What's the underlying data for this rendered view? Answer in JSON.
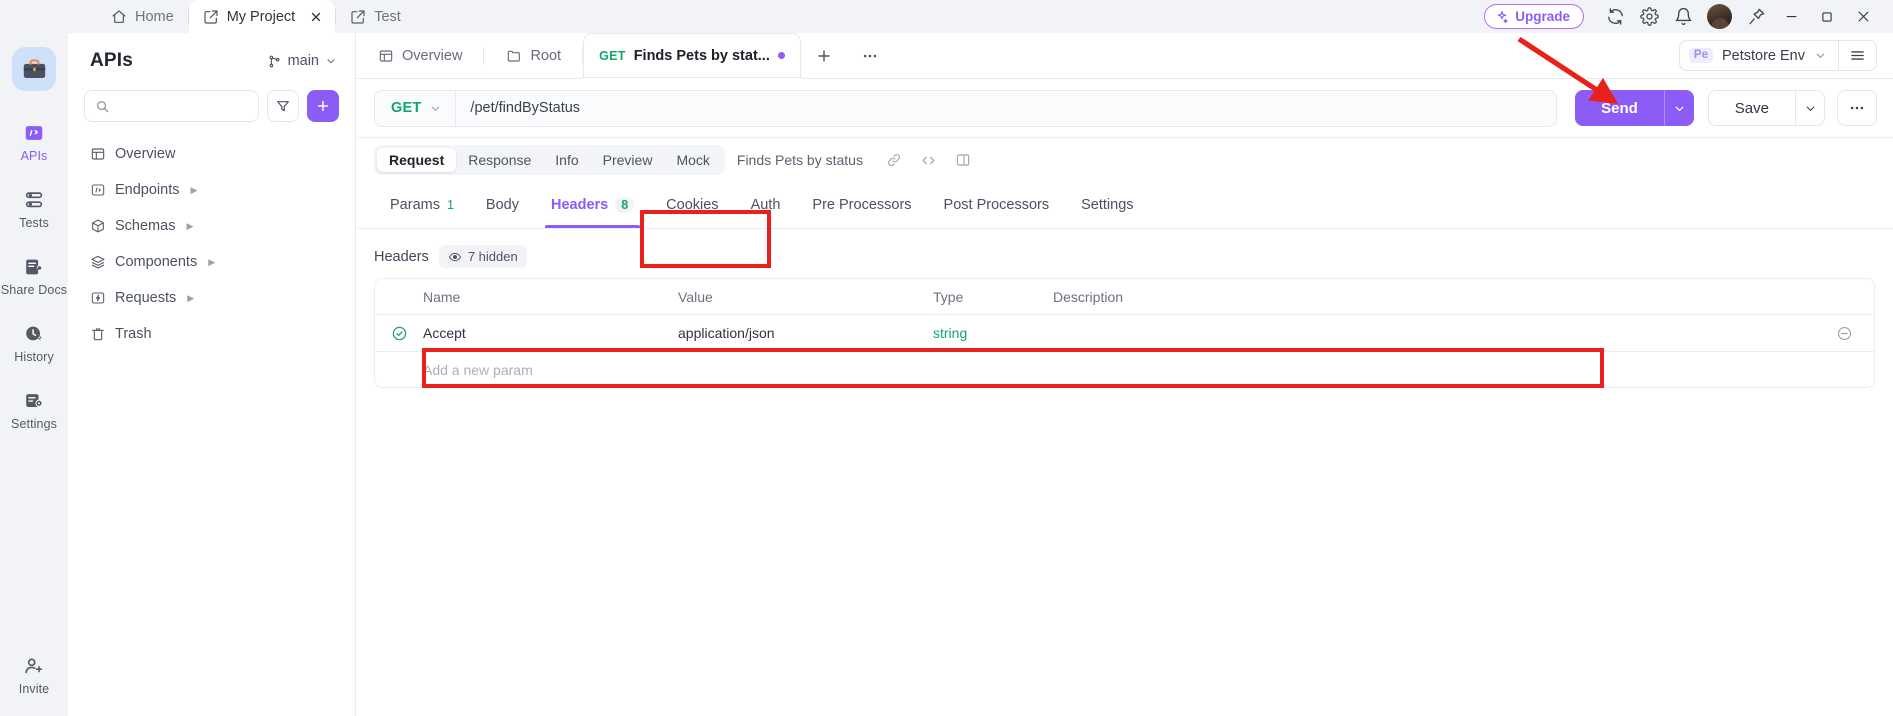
{
  "titlebar": {
    "tabs": [
      {
        "label": "Home",
        "icon": "home-icon",
        "active": false,
        "closable": false
      },
      {
        "label": "My Project",
        "icon": "external-window-icon",
        "active": true,
        "closable": true
      },
      {
        "label": "Test",
        "icon": "external-window-icon",
        "active": false,
        "closable": false
      }
    ],
    "upgrade_label": "Upgrade",
    "icons": [
      "sync-icon",
      "gear-icon",
      "bell-icon",
      "avatar",
      "pin-icon"
    ],
    "window_controls": [
      "minimize-icon",
      "maximize-icon",
      "close-icon"
    ]
  },
  "rail": {
    "logo": "briefcase-icon",
    "items": [
      {
        "label": "APIs",
        "icon": "apis-icon",
        "active": true
      },
      {
        "label": "Tests",
        "icon": "tests-icon",
        "active": false
      },
      {
        "label": "Share Docs",
        "icon": "share-docs-icon",
        "active": false
      },
      {
        "label": "History",
        "icon": "history-icon",
        "active": false
      },
      {
        "label": "Settings",
        "icon": "settings-icon",
        "active": false
      }
    ],
    "bottom": {
      "label": "Invite",
      "icon": "invite-user-icon"
    }
  },
  "panel": {
    "title": "APIs",
    "branch": "main",
    "search_placeholder": "",
    "filter_icon": "filter-icon",
    "add_label": "+",
    "tree": [
      {
        "label": "Overview",
        "icon": "overview-icon",
        "expandable": false
      },
      {
        "label": "Endpoints",
        "icon": "endpoints-icon",
        "expandable": true
      },
      {
        "label": "Schemas",
        "icon": "schemas-icon",
        "expandable": true
      },
      {
        "label": "Components",
        "icon": "components-icon",
        "expandable": true
      },
      {
        "label": "Requests",
        "icon": "requests-icon",
        "expandable": true
      },
      {
        "label": "Trash",
        "icon": "trash-icon",
        "expandable": false
      }
    ]
  },
  "main_tabs": {
    "tabs": [
      {
        "label": "Overview",
        "icon": "overview-icon",
        "active": false,
        "verb": "",
        "dot": false
      },
      {
        "label": "Root",
        "icon": "folder-icon",
        "active": false,
        "verb": "",
        "dot": false
      },
      {
        "label": "Finds Pets by stat...",
        "icon": "",
        "active": true,
        "verb": "GET",
        "dot": true
      }
    ],
    "add_icon": "plus-icon",
    "more_icon": "more-horizontal-icon",
    "env": {
      "badge": "Pe",
      "name": "Petstore Env",
      "caret": "chevron-down-icon",
      "menu_icon": "hamburger-icon"
    }
  },
  "urlbar": {
    "method": "GET",
    "url": "/pet/findByStatus",
    "url_placeholder": "",
    "send_label": "Send",
    "save_label": "Save",
    "more_label": "···"
  },
  "segmented": {
    "items": [
      "Request",
      "Response",
      "Info",
      "Preview",
      "Mock"
    ],
    "active": "Request",
    "title": "Finds Pets by status",
    "icons": [
      "link-icon",
      "code-icon",
      "panel-layout-icon"
    ]
  },
  "subtabs": [
    {
      "label": "Params",
      "count": "1",
      "active": false,
      "count_style": "badge"
    },
    {
      "label": "Body",
      "count": "",
      "active": false,
      "count_style": ""
    },
    {
      "label": "Headers",
      "count": "8",
      "active": true,
      "count_style": "badge"
    },
    {
      "label": "Cookies",
      "count": "",
      "active": false,
      "count_style": ""
    },
    {
      "label": "Auth",
      "count": "",
      "active": false,
      "count_style": ""
    },
    {
      "label": "Pre Processors",
      "count": "",
      "active": false,
      "count_style": ""
    },
    {
      "label": "Post Processors",
      "count": "",
      "active": false,
      "count_style": ""
    },
    {
      "label": "Settings",
      "count": "",
      "active": false,
      "count_style": ""
    }
  ],
  "headers_panel": {
    "label": "Headers",
    "hidden_chip": "7 hidden",
    "hidden_chip_icon": "eye-icon",
    "columns": [
      "Name",
      "Value",
      "Type",
      "Description"
    ],
    "rows": [
      {
        "enabled": true,
        "name": "Accept",
        "value": "application/json",
        "type": "string",
        "description": "",
        "remove_icon": "minus-circle-icon"
      }
    ],
    "add_row_placeholder": "Add a new param"
  },
  "annotations": {
    "color": "#e8211a",
    "boxes": [
      {
        "name": "headers-tab-highlight"
      },
      {
        "name": "accept-row-highlight"
      }
    ],
    "arrow": {
      "name": "send-button-arrow",
      "target": "send-button"
    }
  }
}
